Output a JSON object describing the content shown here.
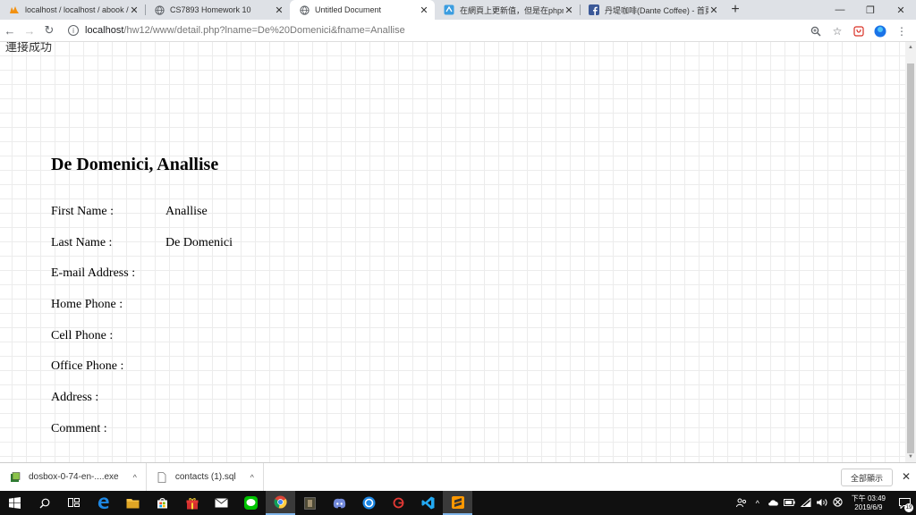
{
  "browser": {
    "tabs": [
      {
        "title": "localhost / localhost / abook / ...",
        "icon": "phpmyadmin-icon",
        "active": false
      },
      {
        "title": "CS7893 Homework 10",
        "icon": "globe-icon",
        "active": false
      },
      {
        "title": "Untitled Document",
        "icon": "globe-icon",
        "active": true
      },
      {
        "title": "在網頁上更新值，但是在phpmy...",
        "icon": "site-icon",
        "active": false
      },
      {
        "title": "丹堤咖啡(Dante Coffee) - 首頁",
        "icon": "facebook-icon",
        "active": false
      }
    ],
    "url_host": "localhost",
    "url_path": "/hw12/www/detail.php?lname=De%20Domenici&fname=Anallise"
  },
  "page": {
    "status": "連接成功",
    "name_heading": "De Domenici, Anallise",
    "fields": [
      {
        "label": "First Name :",
        "value": "Anallise"
      },
      {
        "label": "Last Name :",
        "value": "De Domenici"
      },
      {
        "label": "E-mail Address :",
        "value": ""
      },
      {
        "label": "Home Phone :",
        "value": ""
      },
      {
        "label": "Cell Phone :",
        "value": ""
      },
      {
        "label": "Office Phone :",
        "value": ""
      },
      {
        "label": "Address :",
        "value": ""
      },
      {
        "label": "Comment :",
        "value": ""
      }
    ]
  },
  "downloads": {
    "items": [
      {
        "name": "dosbox-0-74-en-....exe"
      },
      {
        "name": "contacts (1).sql"
      }
    ],
    "show_all": "全部顯示"
  },
  "taskbar": {
    "clock_line1": "下午 03:49",
    "clock_line2": "2019/6/9",
    "notification_count": "19"
  }
}
